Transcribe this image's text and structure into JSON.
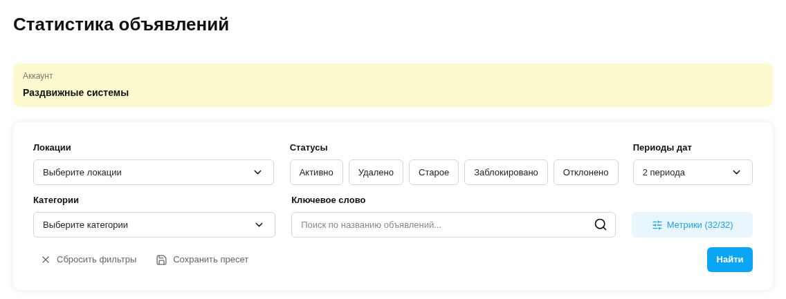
{
  "page_title": "Статистика объявлений",
  "account": {
    "label": "Аккаунт",
    "value": "Раздвижные системы"
  },
  "filters": {
    "locations": {
      "label": "Локации",
      "placeholder": "Выберите локации"
    },
    "statuses": {
      "label": "Статусы",
      "items": [
        {
          "label": "Активно",
          "selected": false
        },
        {
          "label": "Удалено",
          "selected": false
        },
        {
          "label": "Старое",
          "selected": false
        },
        {
          "label": "Заблокировано",
          "selected": false
        },
        {
          "label": "Отклонено",
          "selected": false
        }
      ]
    },
    "date_periods": {
      "label": "Периоды дат",
      "value": "2 периода"
    },
    "categories": {
      "label": "Категории",
      "placeholder": "Выберите категории"
    },
    "keyword": {
      "label": "Ключевое слово",
      "placeholder": "Поиск по названию объявлений..."
    },
    "metrics_button": "Метрики (32/32)",
    "reset_button": "Сбросить фильтры",
    "save_preset_button": "Сохранить пресет",
    "find_button": "Найти"
  }
}
